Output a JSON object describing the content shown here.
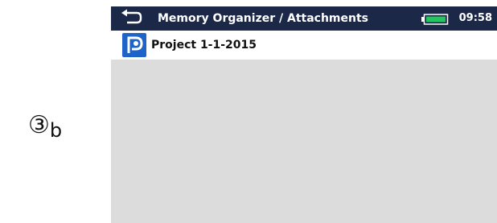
{
  "annotation": {
    "step_label": "③b",
    "circled_number": "③",
    "letter": "b"
  },
  "titlebar": {
    "back_icon": "back-arrow-icon",
    "title": "Memory Organizer / Attachments",
    "battery_icon": "battery-full-icon",
    "battery_level": 1.0,
    "battery_color": "#22c55e",
    "time": "09:58",
    "background_color": "#1b2847"
  },
  "project": {
    "icon": "project-icon",
    "icon_color": "#1e63c8",
    "name": "Project 1-1-2015"
  },
  "content": {
    "background_color": "#dcdcdc"
  }
}
